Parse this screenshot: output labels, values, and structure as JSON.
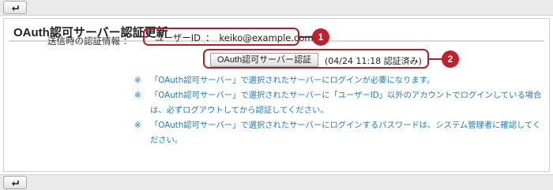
{
  "toolbar": {
    "back_icon": "back-arrow-icon"
  },
  "panel": {
    "title": "OAuth認可サーバー認証更新"
  },
  "form": {
    "label": "送信時の認証情報 ：",
    "user_id_label": "ユーザーID",
    "user_id_sep": "：",
    "user_id_value": "keiko@example.com",
    "auth_button": "OAuth認可サーバー認証",
    "auth_status": "(04/24 11:18 認証済み)"
  },
  "callouts": {
    "one": "1",
    "two": "2"
  },
  "notes": [
    {
      "mark": "※",
      "text": "「OAuth認可サーバー」で選択されたサーバーにログインが必要になります。"
    },
    {
      "mark": "※",
      "text": "「OAuth認可サーバー」で選択されたサーバーに「ユーザーID」以外のアカウントでログインしている場合は、必ずログアウトしてから認証してください。"
    },
    {
      "mark": "※",
      "text": "「OAuth認可サーバー」で選択されたサーバーにログインするパスワードは、システム管理者に確認してください。"
    }
  ],
  "colors": {
    "callout": "#b1202a",
    "note_text": "#1f7ac2",
    "toolbar": "#eaeaea"
  }
}
